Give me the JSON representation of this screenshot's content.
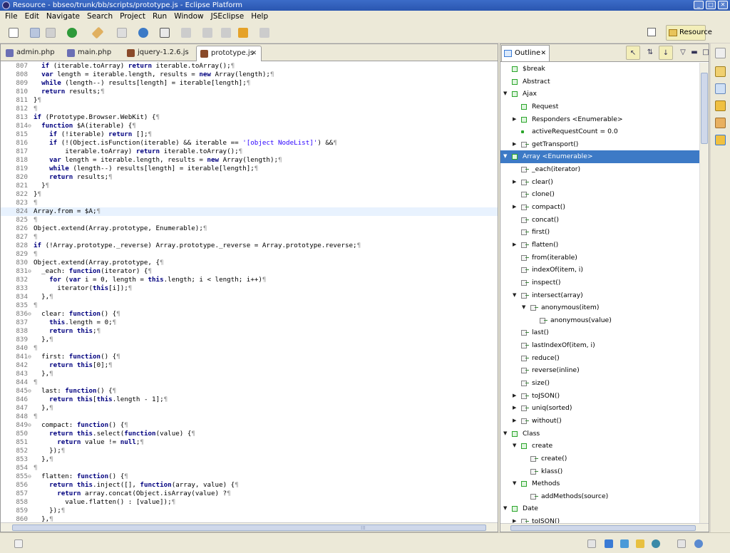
{
  "window": {
    "title": "Resource - bbseo/trunk/bb/scripts/prototype.js - Eclipse Platform"
  },
  "menu": [
    "File",
    "Edit",
    "Navigate",
    "Search",
    "Project",
    "Run",
    "Window",
    "JSEclipse",
    "Help"
  ],
  "perspective": {
    "label": "Resource"
  },
  "editor_tabs": [
    {
      "label": "admin.php",
      "icon": "php-file-icon"
    },
    {
      "label": "main.php",
      "icon": "php-file-icon"
    },
    {
      "label": "jquery-1.2.6.js",
      "icon": "js-file-icon"
    },
    {
      "label": "prototype.js",
      "icon": "js-file-icon",
      "active": true,
      "close": "✕"
    }
  ],
  "code_lines": [
    {
      "n": "807",
      "fold": "",
      "t": "  if (iterable.toArray) return iterable.toArray();¶"
    },
    {
      "n": "808",
      "fold": "",
      "t": "  var length = iterable.length, results = new Array(length);¶"
    },
    {
      "n": "809",
      "fold": "",
      "t": "  while (length--) results[length] = iterable[length];¶"
    },
    {
      "n": "810",
      "fold": "",
      "t": "  return results;¶"
    },
    {
      "n": "811",
      "fold": "",
      "t": "}¶"
    },
    {
      "n": "812",
      "fold": "",
      "t": "¶"
    },
    {
      "n": "813",
      "fold": "",
      "t": "if (Prototype.Browser.WebKit) {¶"
    },
    {
      "n": "814",
      "fold": "⊖",
      "t": "  function $A(iterable) {¶"
    },
    {
      "n": "815",
      "fold": "",
      "t": "    if (!iterable) return [];¶"
    },
    {
      "n": "816",
      "fold": "",
      "t": "    if (!(Object.isFunction(iterable) && iterable == '[object NodeList]') &&¶"
    },
    {
      "n": "817",
      "fold": "",
      "t": "        iterable.toArray) return iterable.toArray();¶"
    },
    {
      "n": "818",
      "fold": "",
      "t": "    var length = iterable.length, results = new Array(length);¶"
    },
    {
      "n": "819",
      "fold": "",
      "t": "    while (length--) results[length] = iterable[length];¶"
    },
    {
      "n": "820",
      "fold": "",
      "t": "    return results;¶"
    },
    {
      "n": "821",
      "fold": "",
      "t": "  }¶"
    },
    {
      "n": "822",
      "fold": "",
      "t": "}¶"
    },
    {
      "n": "823",
      "fold": "",
      "t": "¶"
    },
    {
      "n": "824",
      "fold": "",
      "t": "Array.from = $A;¶",
      "hl": true
    },
    {
      "n": "825",
      "fold": "",
      "t": "¶"
    },
    {
      "n": "826",
      "fold": "",
      "t": "Object.extend(Array.prototype, Enumerable);¶"
    },
    {
      "n": "827",
      "fold": "",
      "t": "¶"
    },
    {
      "n": "828",
      "fold": "",
      "t": "if (!Array.prototype._reverse) Array.prototype._reverse = Array.prototype.reverse;¶"
    },
    {
      "n": "829",
      "fold": "",
      "t": "¶"
    },
    {
      "n": "830",
      "fold": "",
      "t": "Object.extend(Array.prototype, {¶"
    },
    {
      "n": "831",
      "fold": "⊖",
      "t": "  _each: function(iterator) {¶"
    },
    {
      "n": "832",
      "fold": "",
      "t": "    for (var i = 0, length = this.length; i < length; i++)¶"
    },
    {
      "n": "833",
      "fold": "",
      "t": "      iterator(this[i]);¶"
    },
    {
      "n": "834",
      "fold": "",
      "t": "  },¶"
    },
    {
      "n": "835",
      "fold": "",
      "t": "¶"
    },
    {
      "n": "836",
      "fold": "⊖",
      "t": "  clear: function() {¶"
    },
    {
      "n": "837",
      "fold": "",
      "t": "    this.length = 0;¶"
    },
    {
      "n": "838",
      "fold": "",
      "t": "    return this;¶"
    },
    {
      "n": "839",
      "fold": "",
      "t": "  },¶"
    },
    {
      "n": "840",
      "fold": "",
      "t": "¶"
    },
    {
      "n": "841",
      "fold": "⊖",
      "t": "  first: function() {¶"
    },
    {
      "n": "842",
      "fold": "",
      "t": "    return this[0];¶"
    },
    {
      "n": "843",
      "fold": "",
      "t": "  },¶"
    },
    {
      "n": "844",
      "fold": "",
      "t": "¶"
    },
    {
      "n": "845",
      "fold": "⊖",
      "t": "  last: function() {¶"
    },
    {
      "n": "846",
      "fold": "",
      "t": "    return this[this.length - 1];¶"
    },
    {
      "n": "847",
      "fold": "",
      "t": "  },¶"
    },
    {
      "n": "848",
      "fold": "",
      "t": "¶"
    },
    {
      "n": "849",
      "fold": "⊖",
      "t": "  compact: function() {¶"
    },
    {
      "n": "850",
      "fold": "",
      "t": "    return this.select(function(value) {¶"
    },
    {
      "n": "851",
      "fold": "",
      "t": "      return value != null;¶"
    },
    {
      "n": "852",
      "fold": "",
      "t": "    });¶"
    },
    {
      "n": "853",
      "fold": "",
      "t": "  },¶"
    },
    {
      "n": "854",
      "fold": "",
      "t": "¶"
    },
    {
      "n": "855",
      "fold": "⊖",
      "t": "  flatten: function() {¶"
    },
    {
      "n": "856",
      "fold": "",
      "t": "    return this.inject([], function(array, value) {¶"
    },
    {
      "n": "857",
      "fold": "",
      "t": "      return array.concat(Object.isArray(value) ?¶"
    },
    {
      "n": "858",
      "fold": "",
      "t": "        value.flatten() : [value]);¶"
    },
    {
      "n": "859",
      "fold": "",
      "t": "    });¶"
    },
    {
      "n": "860",
      "fold": "",
      "t": "  },¶"
    }
  ],
  "outline": {
    "title": "Outline",
    "nodes": [
      {
        "label": "$break",
        "depth": 0,
        "tw": "",
        "icon": "g"
      },
      {
        "label": "Abstract",
        "depth": 0,
        "tw": "",
        "icon": "g"
      },
      {
        "label": "Ajax",
        "depth": 0,
        "tw": "▼",
        "icon": "g"
      },
      {
        "label": "Request",
        "depth": 1,
        "tw": "",
        "icon": "g"
      },
      {
        "label": "Responders <Enumerable>",
        "depth": 1,
        "tw": "▶",
        "icon": "g"
      },
      {
        "label": "activeRequestCount = 0.0",
        "depth": 1,
        "tw": "",
        "icon": "v"
      },
      {
        "label": "getTransport()",
        "depth": 1,
        "tw": "▶",
        "icon": "f"
      },
      {
        "label": "Array <Enumerable>",
        "depth": 0,
        "tw": "▼",
        "icon": "g",
        "sel": true
      },
      {
        "label": "_each(iterator)",
        "depth": 1,
        "tw": "",
        "icon": "f"
      },
      {
        "label": "clear()",
        "depth": 1,
        "tw": "▶",
        "icon": "f"
      },
      {
        "label": "clone()",
        "depth": 1,
        "tw": "",
        "icon": "f"
      },
      {
        "label": "compact()",
        "depth": 1,
        "tw": "▶",
        "icon": "f"
      },
      {
        "label": "concat()",
        "depth": 1,
        "tw": "",
        "icon": "f"
      },
      {
        "label": "first()",
        "depth": 1,
        "tw": "",
        "icon": "f"
      },
      {
        "label": "flatten()",
        "depth": 1,
        "tw": "▶",
        "icon": "f"
      },
      {
        "label": "from(iterable)",
        "depth": 1,
        "tw": "",
        "icon": "f"
      },
      {
        "label": "indexOf(item, i)",
        "depth": 1,
        "tw": "",
        "icon": "f"
      },
      {
        "label": "inspect()",
        "depth": 1,
        "tw": "",
        "icon": "f"
      },
      {
        "label": "intersect(array)",
        "depth": 1,
        "tw": "▼",
        "icon": "f"
      },
      {
        "label": "anonymous(item)",
        "depth": 2,
        "tw": "▼",
        "icon": "f"
      },
      {
        "label": "anonymous(value)",
        "depth": 3,
        "tw": "",
        "icon": "f"
      },
      {
        "label": "last()",
        "depth": 1,
        "tw": "",
        "icon": "f"
      },
      {
        "label": "lastIndexOf(item, i)",
        "depth": 1,
        "tw": "",
        "icon": "f"
      },
      {
        "label": "reduce()",
        "depth": 1,
        "tw": "",
        "icon": "f"
      },
      {
        "label": "reverse(inline)",
        "depth": 1,
        "tw": "",
        "icon": "f"
      },
      {
        "label": "size()",
        "depth": 1,
        "tw": "",
        "icon": "f"
      },
      {
        "label": "toJSON()",
        "depth": 1,
        "tw": "▶",
        "icon": "f"
      },
      {
        "label": "uniq(sorted)",
        "depth": 1,
        "tw": "▶",
        "icon": "f"
      },
      {
        "label": "without()",
        "depth": 1,
        "tw": "▶",
        "icon": "f"
      },
      {
        "label": "Class",
        "depth": 0,
        "tw": "▼",
        "icon": "g"
      },
      {
        "label": "create",
        "depth": 1,
        "tw": "▼",
        "icon": "g"
      },
      {
        "label": "create()",
        "depth": 2,
        "tw": "",
        "icon": "f"
      },
      {
        "label": "klass()",
        "depth": 2,
        "tw": "",
        "icon": "f"
      },
      {
        "label": "Methods",
        "depth": 1,
        "tw": "▼",
        "icon": "g"
      },
      {
        "label": "addMethods(source)",
        "depth": 2,
        "tw": "",
        "icon": "f"
      },
      {
        "label": "Date",
        "depth": 0,
        "tw": "▼",
        "icon": "g"
      },
      {
        "label": "toJSON()",
        "depth": 1,
        "tw": "▶",
        "icon": "f"
      }
    ]
  }
}
